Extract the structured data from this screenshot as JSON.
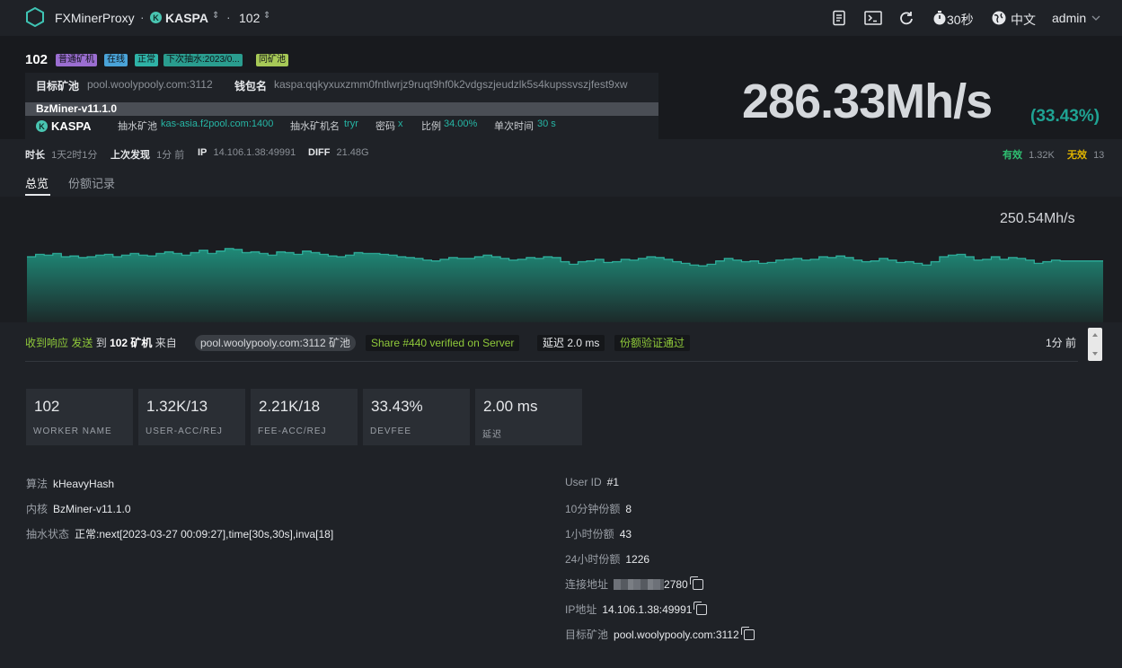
{
  "nav": {
    "app_title": "FXMinerProxy",
    "coin": "KASPA",
    "worker": "102",
    "refresh_interval": "30秒",
    "language": "中文",
    "user": "admin"
  },
  "header": {
    "worker_id": "102",
    "tags": [
      {
        "label": "普通矿机",
        "color": "#9b6ed1"
      },
      {
        "label": "在线",
        "color": "#4aa3d8"
      },
      {
        "label": "正常",
        "color": "#2fb3a7"
      },
      {
        "label": "下次抽水:2023/0...",
        "color": "#2a9d8f"
      },
      {
        "label": "同矿池",
        "color": "#a7c957"
      }
    ],
    "target_pool_label": "目标矿池",
    "target_pool": "pool.woolypooly.com:3112",
    "wallet_label": "钱包名",
    "wallet": "kaspa:qqkyxuxzmm0fntlwrjz9ruqt9hf0k2vdgszjeudzlk5s4kupssvszjfest9xw",
    "core": "BzMiner-v11.1.0",
    "coin": "KASPA",
    "fee_pool_label": "抽水矿池",
    "fee_pool": "kas-asia.f2pool.com:1400",
    "fee_worker_label": "抽水矿机名",
    "fee_worker": "tryr",
    "password_label": "密码",
    "password": "x",
    "ratio_label": "比例",
    "ratio": "34.00%",
    "interval_label": "单次时间",
    "interval": "30 s",
    "hashrate": "286.33Mh/s",
    "hashrate_pct": "(33.43%)"
  },
  "meta": {
    "duration_label": "时长",
    "duration": "1天2时1分",
    "last_seen_label": "上次发现",
    "last_seen": "1分 前",
    "ip_label": "IP",
    "ip": "14.106.1.38:49991",
    "diff_label": "DIFF",
    "diff": "21.48G",
    "valid_label": "有效",
    "valid": "1.32K",
    "invalid_label": "无效",
    "invalid": "13"
  },
  "tabs": [
    "总览",
    "份额记录"
  ],
  "chart": {
    "current_label": "250.54Mh/s"
  },
  "chart_data": {
    "type": "area",
    "title": "",
    "xlabel": "",
    "ylabel": "",
    "series": [
      {
        "values": [
          236,
          239,
          238,
          240,
          236,
          237,
          235,
          236,
          238,
          239,
          236,
          238,
          240,
          238,
          237,
          240,
          242,
          240,
          238,
          241,
          244,
          240,
          243,
          246,
          245,
          241,
          242,
          240,
          238,
          242,
          241,
          239,
          243,
          241,
          239,
          237,
          236,
          238,
          241,
          240,
          240,
          239,
          238,
          236,
          235,
          234,
          232,
          231,
          233,
          235,
          234,
          234,
          236,
          238,
          236,
          234,
          232,
          233,
          235,
          234,
          236,
          235,
          230,
          227,
          230,
          231,
          233,
          229,
          230,
          233,
          232,
          234,
          236,
          235,
          233,
          230,
          228,
          226,
          225,
          227,
          231,
          234,
          232,
          230,
          231,
          228,
          229,
          232,
          233,
          234,
          232,
          233,
          236,
          235,
          237,
          235,
          232,
          230,
          231,
          234,
          232,
          229,
          230,
          228,
          226,
          230,
          236,
          238,
          239,
          236,
          232,
          233,
          236,
          233,
          235,
          234,
          232,
          228,
          230,
          232,
          231,
          231,
          231,
          231,
          231
        ]
      }
    ],
    "ylim": [
      200,
      260
    ]
  },
  "log": {
    "prefix": "收到响应",
    "send": "发送",
    "to": "到",
    "target": "102 矿机",
    "from": "来自",
    "pool_chip": "pool.woolypooly.com:3112 矿池",
    "share_chip": "Share #440 verified on Server",
    "latency_chip": "延迟 2.0 ms",
    "verify_chip": "份额验证通过",
    "time": "1分 前"
  },
  "cards": [
    {
      "value": "102",
      "label": "WORKER NAME"
    },
    {
      "value": "1.32K/13",
      "label": "USER-ACC/REJ"
    },
    {
      "value": "2.21K/18",
      "label": "FEE-ACC/REJ"
    },
    {
      "value": "33.43%",
      "label": "DEVFEE"
    },
    {
      "value": "2.00 ms",
      "label": "延迟"
    }
  ],
  "details_left": [
    {
      "key": "算法",
      "value": "kHeavyHash"
    },
    {
      "key": "内核",
      "value": "BzMiner-v11.1.0"
    },
    {
      "key": "抽水状态",
      "value": "正常:next[2023-03-27 00:09:27],time[30s,30s],inva[18]"
    }
  ],
  "details_right": [
    {
      "key": "User ID",
      "value": "#1"
    },
    {
      "key": "10分钟份额",
      "value": "8"
    },
    {
      "key": "1小时份额",
      "value": "43"
    },
    {
      "key": "24小时份额",
      "value": "1226"
    },
    {
      "key": "连接地址",
      "value": "2780"
    },
    {
      "key": "IP地址",
      "value": "14.106.1.38:49991"
    },
    {
      "key": "目标矿池",
      "value": "pool.woolypooly.com:3112"
    }
  ]
}
